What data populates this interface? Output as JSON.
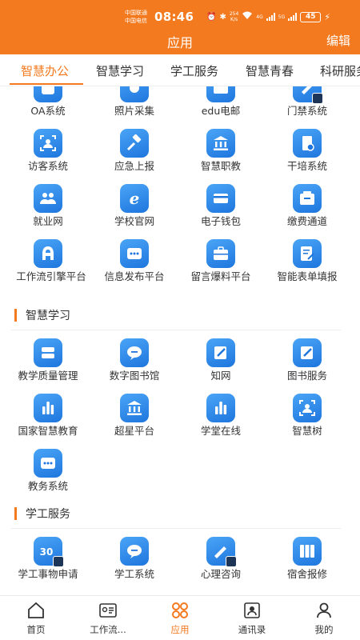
{
  "status_bar": {
    "carrier1": "中国联通",
    "carrier2": "中国电信",
    "time": "08:46",
    "speed": "254",
    "speed_unit": "K/s",
    "net1": "4G",
    "net2": "5G",
    "battery": "45"
  },
  "header": {
    "title": "应用",
    "edit": "编辑"
  },
  "tabs": [
    {
      "label": "智慧办公",
      "active": true
    },
    {
      "label": "智慧学习"
    },
    {
      "label": "学工服务"
    },
    {
      "label": "智慧青春"
    },
    {
      "label": "科研服务"
    }
  ],
  "sections": {
    "office": {
      "items": [
        {
          "label": "OA系统",
          "icon": "oa-icon"
        },
        {
          "label": "照片采集",
          "icon": "camera-icon"
        },
        {
          "label": "edu电邮",
          "icon": "mail-icon"
        },
        {
          "label": "门禁系统",
          "icon": "access-icon"
        },
        {
          "label": "访客系统",
          "icon": "visitor-icon"
        },
        {
          "label": "应急上报",
          "icon": "gavel-icon"
        },
        {
          "label": "智慧职教",
          "icon": "bank-icon"
        },
        {
          "label": "干培系统",
          "icon": "training-icon"
        },
        {
          "label": "就业网",
          "icon": "people-icon"
        },
        {
          "label": "学校官网",
          "icon": "ie-icon"
        },
        {
          "label": "电子钱包",
          "icon": "card-icon"
        },
        {
          "label": "缴费通道",
          "icon": "wallet-icon"
        },
        {
          "label": "工作流引擎平台",
          "icon": "a-icon"
        },
        {
          "label": "信息发布平台",
          "icon": "message-icon"
        },
        {
          "label": "留言爆料平台",
          "icon": "briefcase-icon"
        },
        {
          "label": "智能表单填报",
          "icon": "form-icon"
        }
      ]
    },
    "learning": {
      "title": "智慧学习",
      "items": [
        {
          "label": "教学质量管理",
          "icon": "server-icon"
        },
        {
          "label": "数字图书馆",
          "icon": "chat-icon"
        },
        {
          "label": "知网",
          "icon": "edit-icon"
        },
        {
          "label": "图书服务",
          "icon": "edit-icon"
        },
        {
          "label": "国家智慧教育",
          "icon": "bar-chart-icon"
        },
        {
          "label": "超星平台",
          "icon": "bank-icon"
        },
        {
          "label": "学堂在线",
          "icon": "bar-chart-icon"
        },
        {
          "label": "智慧树",
          "icon": "visitor-icon"
        },
        {
          "label": "教务系统",
          "icon": "message-icon"
        }
      ]
    },
    "student": {
      "title": "学工服务",
      "items": [
        {
          "label": "学工事物申请",
          "icon": "calendar-icon"
        },
        {
          "label": "学工系统",
          "icon": "chat-icon"
        },
        {
          "label": "心理咨询",
          "icon": "pen-icon"
        },
        {
          "label": "宿舍报修",
          "icon": "columns-icon"
        }
      ]
    }
  },
  "bottom_nav": [
    {
      "label": "首页",
      "icon": "home-icon"
    },
    {
      "label": "工作流...",
      "icon": "id-card-icon"
    },
    {
      "label": "应用",
      "icon": "apps-icon",
      "active": true
    },
    {
      "label": "通讯录",
      "icon": "contacts-icon"
    },
    {
      "label": "我的",
      "icon": "user-icon"
    }
  ],
  "colors": {
    "accent": "#f47a1f",
    "icon_blue": "#2f8cec"
  }
}
